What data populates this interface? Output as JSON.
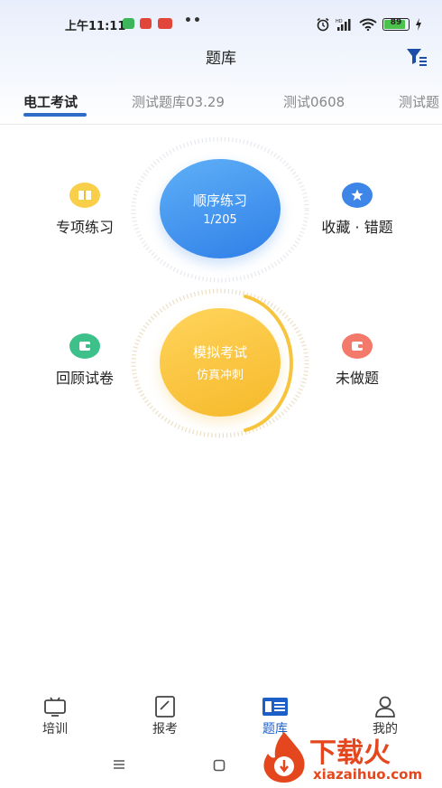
{
  "status_bar": {
    "time": "上午11:11",
    "more": "••",
    "battery": "89"
  },
  "header": {
    "title": "题库"
  },
  "tabs": [
    {
      "label": "电工考试"
    },
    {
      "label": "测试题库03.29"
    },
    {
      "label": "测试0608"
    },
    {
      "label": "测试题"
    }
  ],
  "practice": {
    "sequential": {
      "title": "顺序练习",
      "progress": "1/205"
    },
    "special": {
      "label": "专项练习"
    },
    "favorites": {
      "label": "收藏 · 错题"
    }
  },
  "exam": {
    "mock": {
      "title": "模拟考试",
      "subtitle": "仿真冲刺"
    },
    "review": {
      "label": "回顾试卷"
    },
    "undone": {
      "label": "未做题"
    }
  },
  "bottom_nav": [
    {
      "label": "培训"
    },
    {
      "label": "报考"
    },
    {
      "label": "题库"
    },
    {
      "label": "我的"
    }
  ],
  "watermark": {
    "brand": "下载火",
    "domain": "xiazaihuo.com"
  },
  "colors": {
    "accent": "#1d5fc8",
    "blue_circle": "#3d8ff0",
    "yellow_circle": "#f8c23a",
    "watermark": "#e4471e"
  }
}
